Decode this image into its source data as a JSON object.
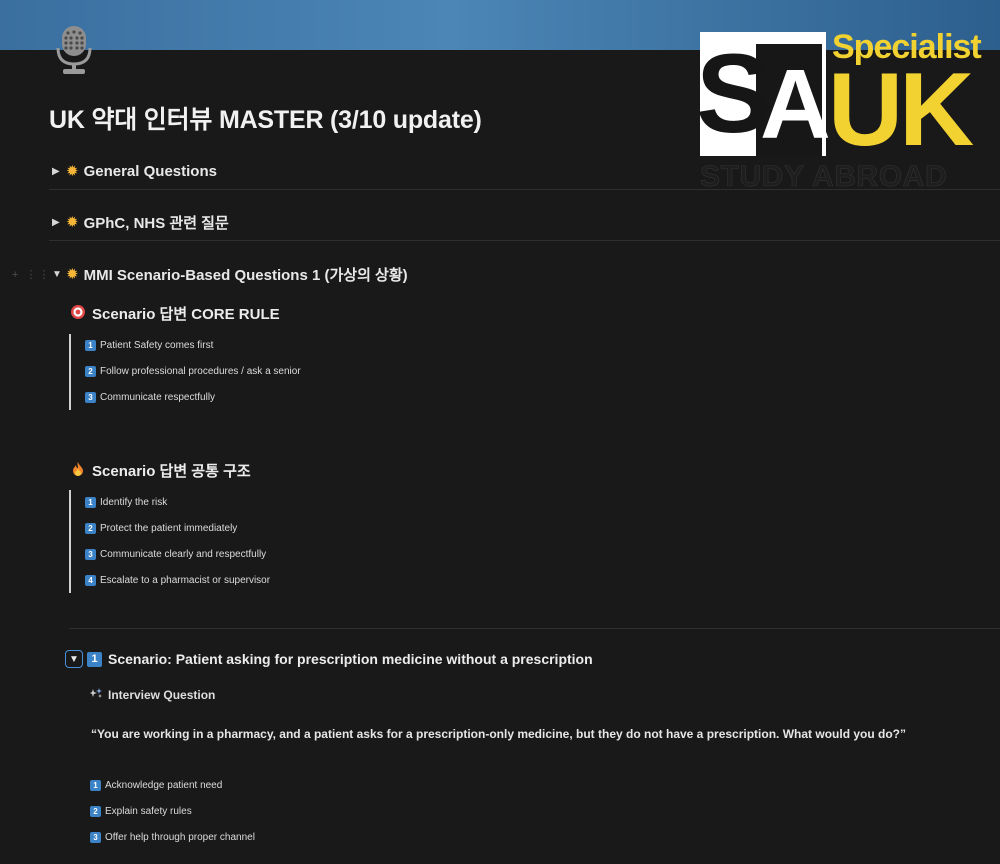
{
  "page": {
    "title": "UK 약대 인터뷰 MASTER (3/10 update)",
    "icon": "microphone-icon"
  },
  "logo": {
    "specialist": "Specialist",
    "sa_s": "S",
    "sa_a": "A",
    "uk": "UK",
    "study_abroad": "STUDY ABROAD",
    "colors": {
      "yellow": "#f2d231",
      "white": "#ffffff",
      "black": "#161616"
    }
  },
  "toggles": [
    {
      "icon": "sun-icon",
      "label": "General Questions",
      "expanded": false
    },
    {
      "icon": "sun-icon",
      "label": "GPhC, NHS 관련 질문",
      "expanded": false
    },
    {
      "icon": "sun-icon",
      "label": "MMI Scenario-Based Questions 1 (가상의 상황)",
      "expanded": true
    }
  ],
  "core_rule": {
    "icon": "target-icon",
    "heading": "Scenario 답변 CORE RULE",
    "items": [
      {
        "num": "1",
        "text": "Patient Safety comes first"
      },
      {
        "num": "2",
        "text": "Follow professional procedures / ask a senior"
      },
      {
        "num": "3",
        "text": "Communicate respectfully"
      }
    ]
  },
  "structure": {
    "icon": "fire-icon",
    "heading": "Scenario 답변 공통 구조",
    "items": [
      {
        "num": "1",
        "text": "Identify the risk"
      },
      {
        "num": "2",
        "text": "Protect the patient immediately"
      },
      {
        "num": "3",
        "text": "Communicate clearly and respectfully"
      },
      {
        "num": "4",
        "text": "Escalate to a pharmacist or supervisor"
      }
    ]
  },
  "scenario": {
    "num": "1",
    "title": "Scenario: Patient asking for prescription medicine without a prescription",
    "question_icon": "sparkle-icon",
    "question_label": "Interview Question",
    "question_text": "“You are working in a pharmacy, and a patient asks for a prescription-only medicine, but they do not have a prescription. What would you do?”",
    "steps": [
      {
        "num": "1",
        "text": "Acknowledge patient need"
      },
      {
        "num": "2",
        "text": "Explain safety rules"
      },
      {
        "num": "3",
        "text": "Offer help through proper channel"
      }
    ]
  },
  "colors": {
    "background": "#191919",
    "accent_blue": "#3b82c6",
    "cover_blue": "#4b86b6"
  }
}
